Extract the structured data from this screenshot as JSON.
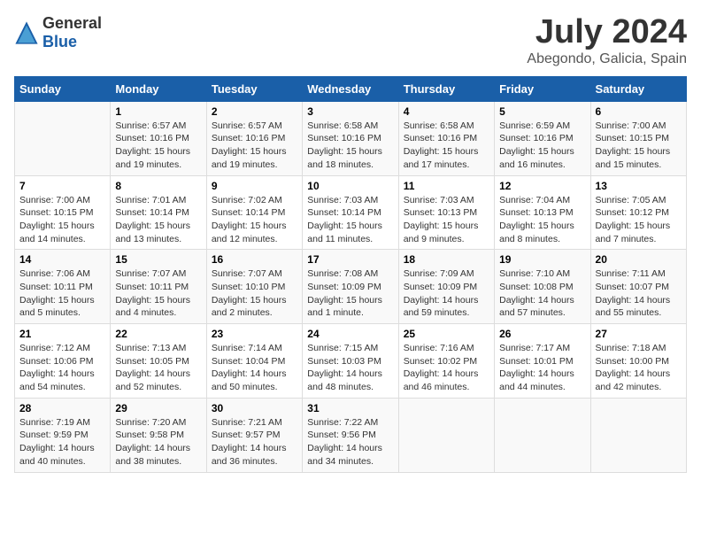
{
  "logo": {
    "general": "General",
    "blue": "Blue"
  },
  "title": "July 2024",
  "subtitle": "Abegondo, Galicia, Spain",
  "headers": [
    "Sunday",
    "Monday",
    "Tuesday",
    "Wednesday",
    "Thursday",
    "Friday",
    "Saturday"
  ],
  "weeks": [
    [
      {
        "day": "",
        "info": ""
      },
      {
        "day": "1",
        "info": "Sunrise: 6:57 AM\nSunset: 10:16 PM\nDaylight: 15 hours\nand 19 minutes."
      },
      {
        "day": "2",
        "info": "Sunrise: 6:57 AM\nSunset: 10:16 PM\nDaylight: 15 hours\nand 19 minutes."
      },
      {
        "day": "3",
        "info": "Sunrise: 6:58 AM\nSunset: 10:16 PM\nDaylight: 15 hours\nand 18 minutes."
      },
      {
        "day": "4",
        "info": "Sunrise: 6:58 AM\nSunset: 10:16 PM\nDaylight: 15 hours\nand 17 minutes."
      },
      {
        "day": "5",
        "info": "Sunrise: 6:59 AM\nSunset: 10:16 PM\nDaylight: 15 hours\nand 16 minutes."
      },
      {
        "day": "6",
        "info": "Sunrise: 7:00 AM\nSunset: 10:15 PM\nDaylight: 15 hours\nand 15 minutes."
      }
    ],
    [
      {
        "day": "7",
        "info": ""
      },
      {
        "day": "8",
        "info": "Sunrise: 7:01 AM\nSunset: 10:14 PM\nDaylight: 15 hours\nand 13 minutes."
      },
      {
        "day": "9",
        "info": "Sunrise: 7:02 AM\nSunset: 10:14 PM\nDaylight: 15 hours\nand 12 minutes."
      },
      {
        "day": "10",
        "info": "Sunrise: 7:03 AM\nSunset: 10:14 PM\nDaylight: 15 hours\nand 11 minutes."
      },
      {
        "day": "11",
        "info": "Sunrise: 7:03 AM\nSunset: 10:13 PM\nDaylight: 15 hours\nand 9 minutes."
      },
      {
        "day": "12",
        "info": "Sunrise: 7:04 AM\nSunset: 10:13 PM\nDaylight: 15 hours\nand 8 minutes."
      },
      {
        "day": "13",
        "info": "Sunrise: 7:05 AM\nSunset: 10:12 PM\nDaylight: 15 hours\nand 7 minutes."
      }
    ],
    [
      {
        "day": "14",
        "info": ""
      },
      {
        "day": "15",
        "info": "Sunrise: 7:07 AM\nSunset: 10:11 PM\nDaylight: 15 hours\nand 4 minutes."
      },
      {
        "day": "16",
        "info": "Sunrise: 7:07 AM\nSunset: 10:10 PM\nDaylight: 15 hours\nand 2 minutes."
      },
      {
        "day": "17",
        "info": "Sunrise: 7:08 AM\nSunset: 10:09 PM\nDaylight: 15 hours\nand 1 minute."
      },
      {
        "day": "18",
        "info": "Sunrise: 7:09 AM\nSunset: 10:09 PM\nDaylight: 14 hours\nand 59 minutes."
      },
      {
        "day": "19",
        "info": "Sunrise: 7:10 AM\nSunset: 10:08 PM\nDaylight: 14 hours\nand 57 minutes."
      },
      {
        "day": "20",
        "info": "Sunrise: 7:11 AM\nSunset: 10:07 PM\nDaylight: 14 hours\nand 55 minutes."
      }
    ],
    [
      {
        "day": "21",
        "info": ""
      },
      {
        "day": "22",
        "info": "Sunrise: 7:13 AM\nSunset: 10:05 PM\nDaylight: 14 hours\nand 52 minutes."
      },
      {
        "day": "23",
        "info": "Sunrise: 7:14 AM\nSunset: 10:04 PM\nDaylight: 14 hours\nand 50 minutes."
      },
      {
        "day": "24",
        "info": "Sunrise: 7:15 AM\nSunset: 10:03 PM\nDaylight: 14 hours\nand 48 minutes."
      },
      {
        "day": "25",
        "info": "Sunrise: 7:16 AM\nSunset: 10:02 PM\nDaylight: 14 hours\nand 46 minutes."
      },
      {
        "day": "26",
        "info": "Sunrise: 7:17 AM\nSunset: 10:01 PM\nDaylight: 14 hours\nand 44 minutes."
      },
      {
        "day": "27",
        "info": "Sunrise: 7:18 AM\nSunset: 10:00 PM\nDaylight: 14 hours\nand 42 minutes."
      }
    ],
    [
      {
        "day": "28",
        "info": "Sunrise: 7:19 AM\nSunset: 9:59 PM\nDaylight: 14 hours\nand 40 minutes."
      },
      {
        "day": "29",
        "info": "Sunrise: 7:20 AM\nSunset: 9:58 PM\nDaylight: 14 hours\nand 38 minutes."
      },
      {
        "day": "30",
        "info": "Sunrise: 7:21 AM\nSunset: 9:57 PM\nDaylight: 14 hours\nand 36 minutes."
      },
      {
        "day": "31",
        "info": "Sunrise: 7:22 AM\nSunset: 9:56 PM\nDaylight: 14 hours\nand 34 minutes."
      },
      {
        "day": "",
        "info": ""
      },
      {
        "day": "",
        "info": ""
      },
      {
        "day": "",
        "info": ""
      }
    ]
  ],
  "week7_sunday": {
    "day": "7",
    "info": "Sunrise: 7:00 AM\nSunset: 10:15 PM\nDaylight: 15 hours\nand 14 minutes."
  },
  "week14_sunday": {
    "day": "14",
    "info": "Sunrise: 7:06 AM\nSunset: 10:11 PM\nDaylight: 15 hours\nand 5 minutes."
  },
  "week21_sunday": {
    "day": "21",
    "info": "Sunrise: 7:12 AM\nSunset: 10:06 PM\nDaylight: 14 hours\nand 54 minutes."
  }
}
